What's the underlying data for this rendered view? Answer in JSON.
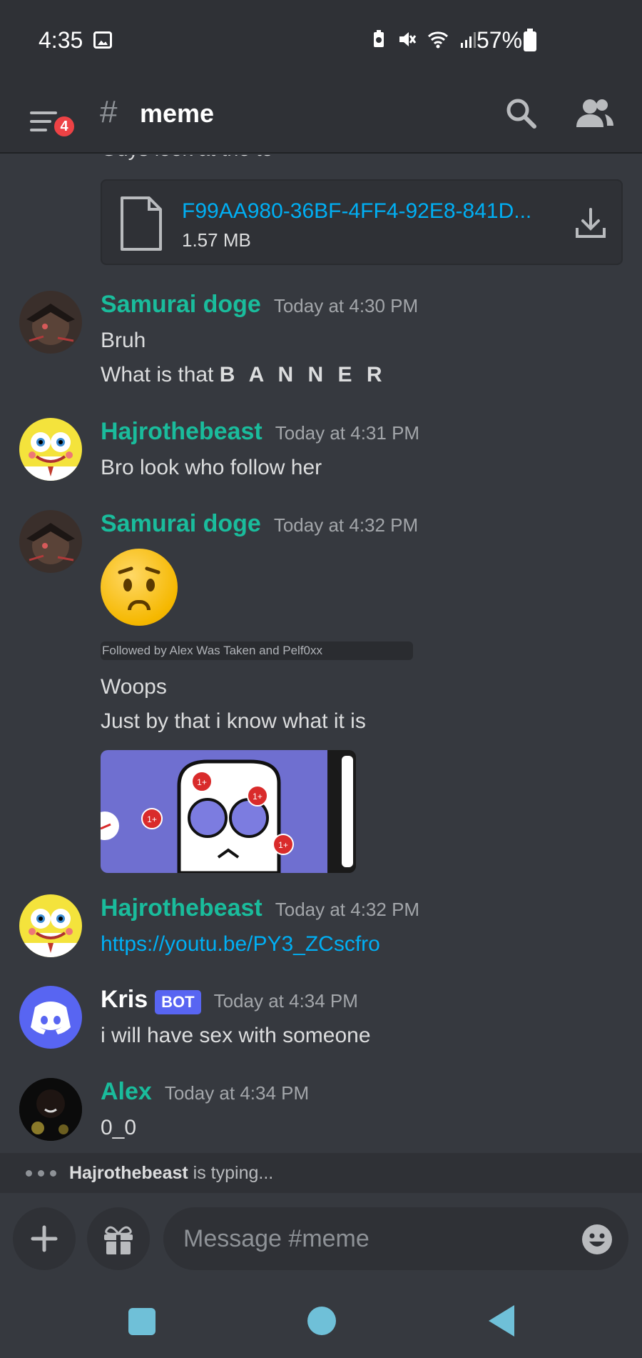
{
  "status_bar": {
    "time": "4:35",
    "battery_percent": "57%",
    "icons": [
      "image-icon",
      "battery-saver-icon",
      "mute-icon",
      "wifi-icon",
      "signal-icon",
      "battery-icon"
    ]
  },
  "header": {
    "channel_name": "meme",
    "hash": "#",
    "menu_badge_count": "4",
    "badge_color": "#ed4245"
  },
  "attachment": {
    "cut_off_text": "Guys look at the to",
    "file_name": "F99AA980-36BF-4FF4-92E8-841D...",
    "file_size": "1.57 MB"
  },
  "messages": [
    {
      "username": "Samurai doge",
      "timestamp": "Today at 4:30 PM",
      "lines": [
        "Bruh",
        "What is that "
      ],
      "emphasis": "B A N N E R"
    },
    {
      "username": "Hajrothebeast",
      "timestamp": "Today at 4:31 PM",
      "lines": [
        "Bro look who follow her"
      ]
    },
    {
      "username": "Samurai doge",
      "timestamp": "Today at 4:32 PM",
      "sticker_caption": "Followed by Alex Was Taken and Pelf0xx",
      "lines": [
        "Woops",
        "Just by that i know what it is"
      ],
      "image_badge_text": "1+"
    },
    {
      "username": "Hajrothebeast",
      "timestamp": "Today at 4:32 PM",
      "link": "https://youtu.be/PY3_ZCscfro"
    },
    {
      "username": "Kris",
      "bot_tag": "BOT",
      "timestamp": "Today at 4:34 PM",
      "lines": [
        "i will have sex with someone"
      ]
    },
    {
      "username": "Alex",
      "timestamp": "Today at 4:34 PM",
      "lines": [
        "0_0"
      ]
    }
  ],
  "typing": {
    "user": "Hajrothebeast",
    "suffix": " is typing..."
  },
  "composer": {
    "placeholder": "Message #meme"
  },
  "colors": {
    "username": "#1abc9c",
    "link": "#00aff4",
    "bot_tag": "#5865f2",
    "nav_buttons": "#6fc0d8"
  }
}
